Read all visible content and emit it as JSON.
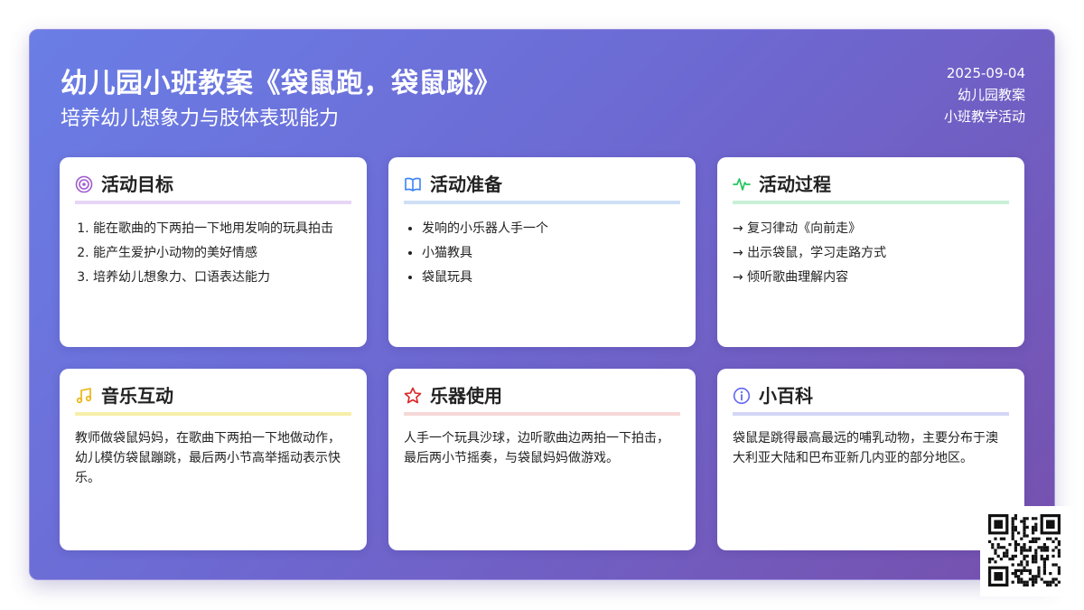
{
  "header": {
    "title": "幼儿园小班教案《袋鼠跑，袋鼠跳》",
    "subtitle": "培养幼儿想象力与肢体表现能力",
    "date": "2025-09-04",
    "category": "幼儿园教案",
    "activity_type": "小班教学活动"
  },
  "cards": [
    {
      "title": "活动目标",
      "icon": "target-icon",
      "accent": "#a05ad0",
      "underline": "#e6d6f6",
      "items": [
        "能在歌曲的下两拍一下地用发响的玩具拍击",
        "能产生爱护小动物的美好情感",
        "培养幼儿想象力、口语表达能力"
      ]
    },
    {
      "title": "活动准备",
      "icon": "book-open-icon",
      "accent": "#3b82f6",
      "underline": "#cfe0f6",
      "items": [
        "发响的小乐器人手一个",
        "小猫教具",
        "袋鼠玩具"
      ]
    },
    {
      "title": "活动过程",
      "icon": "activity-icon",
      "accent": "#22c55e",
      "underline": "#c8f0d8",
      "steps": [
        "→ 复习律动《向前走》",
        "→ 出示袋鼠，学习走路方式",
        "→ 倾听歌曲理解内容"
      ]
    },
    {
      "title": "音乐互动",
      "icon": "music-icon",
      "accent": "#eab308",
      "underline": "#f7efa8",
      "text": "教师做袋鼠妈妈，在歌曲下两拍一下地做动作，幼儿模仿袋鼠蹦跳，最后两小节高举摇动表示快乐。"
    },
    {
      "title": "乐器使用",
      "icon": "star-icon",
      "accent": "#dc2626",
      "underline": "#f6d8d8",
      "text": "人手一个玩具沙球，边听歌曲边两拍一下拍击，最后两小节摇奏，与袋鼠妈妈做游戏。"
    },
    {
      "title": "小百科",
      "icon": "info-icon",
      "accent": "#6366f1",
      "underline": "#d3d6f6",
      "text": "袋鼠是跳得最高最远的哺乳动物，主要分布于澳大利亚大陆和巴布亚新几内亚的部分地区。"
    }
  ]
}
